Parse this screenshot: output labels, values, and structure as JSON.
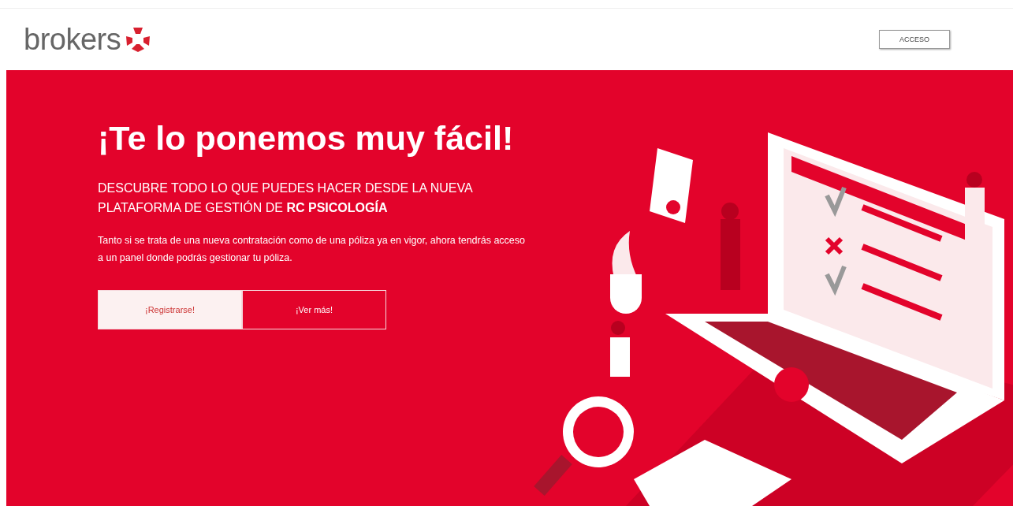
{
  "header": {
    "logo": "brokers",
    "login_button": "ACCESO"
  },
  "hero": {
    "title": "¡Te lo ponemos muy fácil!",
    "subtitle": "DESCUBRE TODO LO QUE PUEDES HACER DESDE LA NUEVA PLATAFORMA DE GESTIÓN DE **RC PSICOLOGÍA**",
    "body": "Tanto si se trata de una nueva contratación como de una póliza ya en vigor, ahora tendrás acceso a un panel donde podrás gestionar tu póliza.",
    "buttons": [
      {
        "label": "¡Registrarse!",
        "kind": "filled"
      },
      {
        "label": "¡Ver más!",
        "kind": "outline"
      }
    ]
  }
}
